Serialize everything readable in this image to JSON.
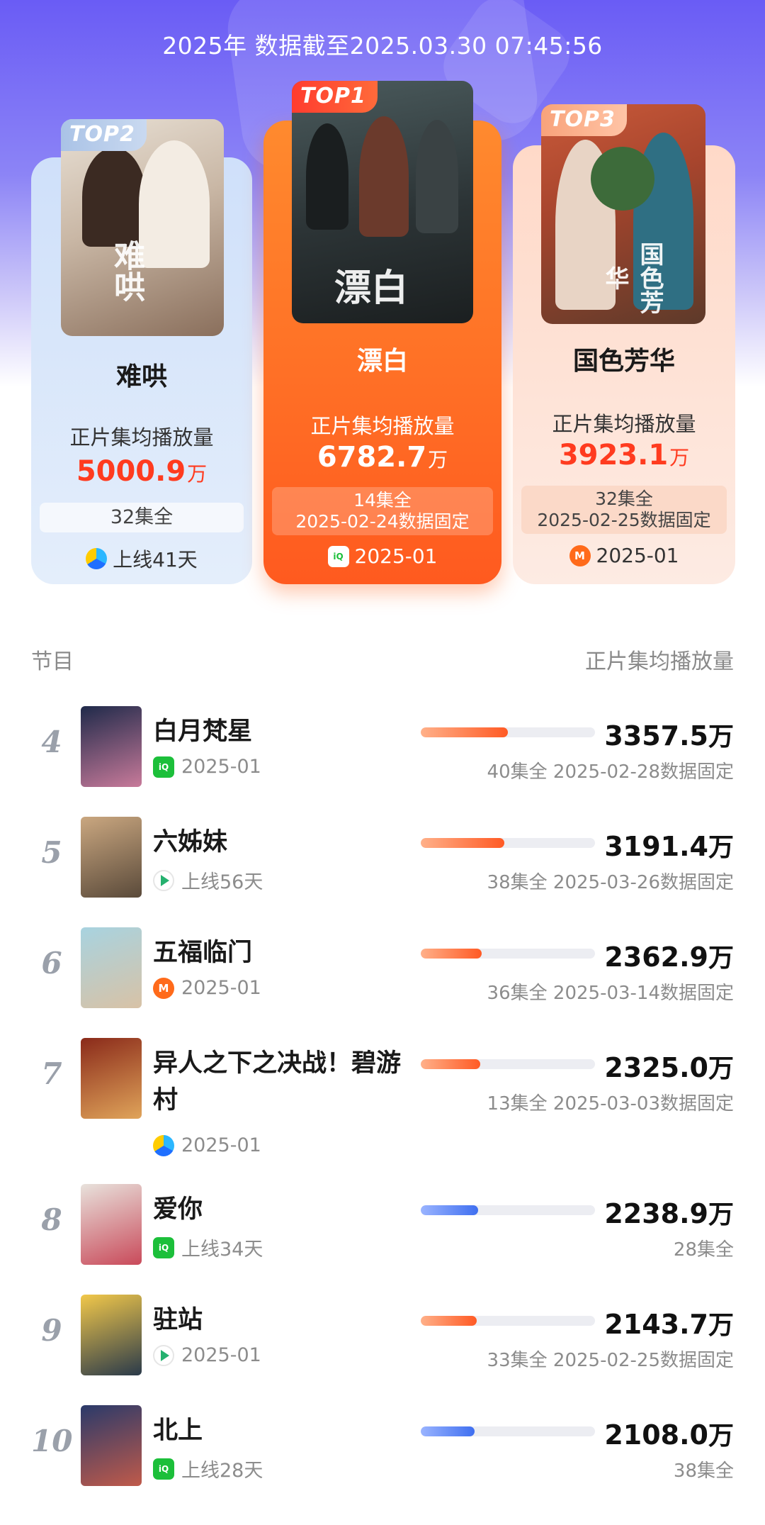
{
  "header": {
    "timestamp": "2025年 数据截至2025.03.30 07:45:56"
  },
  "podium": {
    "metric_label": "正片集均播放量",
    "unit": "万",
    "top1": {
      "badge": "TOP1",
      "title": "漂白",
      "poster_art": "漂白",
      "value": "6782.7",
      "episodes": "14集全",
      "fixed_note": "2025-02-24数据固定",
      "platform_icon": "iqiyi-icon",
      "platform_text": "2025-01"
    },
    "top2": {
      "badge": "TOP2",
      "title": "难哄",
      "poster_art": "难哄",
      "value": "5000.9",
      "episodes": "32集全",
      "platform_icon": "youku-icon",
      "platform_text": "上线41天"
    },
    "top3": {
      "badge": "TOP3",
      "title": "国色芳华",
      "poster_art": "国色芳华",
      "value": "3923.1",
      "episodes": "32集全",
      "fixed_note": "2025-02-25数据固定",
      "platform_icon": "mgtv-icon",
      "platform_text": "2025-01"
    }
  },
  "list": {
    "header_left": "节目",
    "header_right": "正片集均播放量",
    "items": [
      {
        "rank": "4",
        "title": "白月梵星",
        "platform_icon": "iqiyi-icon",
        "platform_text": "2025-01",
        "value": "3357.5",
        "unit": "万",
        "detail": "40集全  2025-02-28数据固定",
        "bar_fraction": 0.5,
        "bar_color": "orange"
      },
      {
        "rank": "5",
        "title": "六姊妹",
        "platform_icon": "tencent-video-icon",
        "platform_text": "上线56天",
        "value": "3191.4",
        "unit": "万",
        "detail": "38集全  2025-03-26数据固定",
        "bar_fraction": 0.48,
        "bar_color": "orange"
      },
      {
        "rank": "6",
        "title": "五福临门",
        "platform_icon": "mgtv-icon",
        "platform_text": "2025-01",
        "value": "2362.9",
        "unit": "万",
        "detail": "36集全  2025-03-14数据固定",
        "bar_fraction": 0.35,
        "bar_color": "orange"
      },
      {
        "rank": "7",
        "title": "异人之下之决战！碧游村",
        "platform_icon": "youku-icon",
        "platform_text": "2025-01",
        "value": "2325.0",
        "unit": "万",
        "detail": "13集全  2025-03-03数据固定",
        "bar_fraction": 0.34,
        "bar_color": "orange"
      },
      {
        "rank": "8",
        "title": "爱你",
        "platform_icon": "iqiyi-icon",
        "platform_text": "上线34天",
        "value": "2238.9",
        "unit": "万",
        "detail": "28集全",
        "bar_fraction": 0.33,
        "bar_color": "blue"
      },
      {
        "rank": "9",
        "title": "驻站",
        "platform_icon": "tencent-video-icon",
        "platform_text": "2025-01",
        "value": "2143.7",
        "unit": "万",
        "detail": "33集全  2025-02-25数据固定",
        "bar_fraction": 0.32,
        "bar_color": "orange"
      },
      {
        "rank": "10",
        "title": "北上",
        "platform_icon": "iqiyi-icon",
        "platform_text": "上线28天",
        "value": "2108.0",
        "unit": "万",
        "detail": "38集全",
        "bar_fraction": 0.31,
        "bar_color": "blue"
      }
    ]
  },
  "colors": {
    "accent_red": "#ff3b1f",
    "top1_orange": "#ff5a1f",
    "bar_orange": "#ff5a24",
    "bar_blue": "#3f6ff0",
    "hero_purple": "#6a5cf5"
  }
}
